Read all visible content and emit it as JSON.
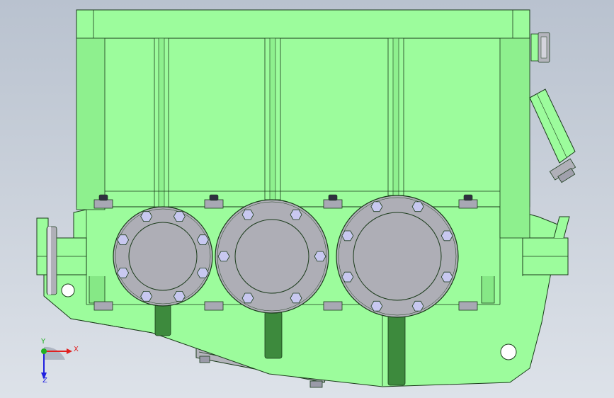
{
  "viewport": {
    "background_top": "#b9c2cf",
    "background_bottom": "#dde2e9"
  },
  "model": {
    "name": "gearbox-housing",
    "body_color": "#9cfc9c",
    "body_shade_color": "#7ee07e",
    "cover_color": "#aeaeb6",
    "bolt_color": "#c8c8f0",
    "shaft_color": "#3d8a3d",
    "outline_color": "#1a3a1a",
    "bearing_covers": [
      {
        "name": "left",
        "bolts": 8
      },
      {
        "name": "middle",
        "bolts": 6
      },
      {
        "name": "right",
        "bolts": 8
      }
    ]
  },
  "triad": {
    "x_label": "X",
    "y_label": "Y",
    "z_label": "Z",
    "x_color": "#e02020",
    "y_color": "#20b020",
    "z_color": "#2020e0"
  }
}
